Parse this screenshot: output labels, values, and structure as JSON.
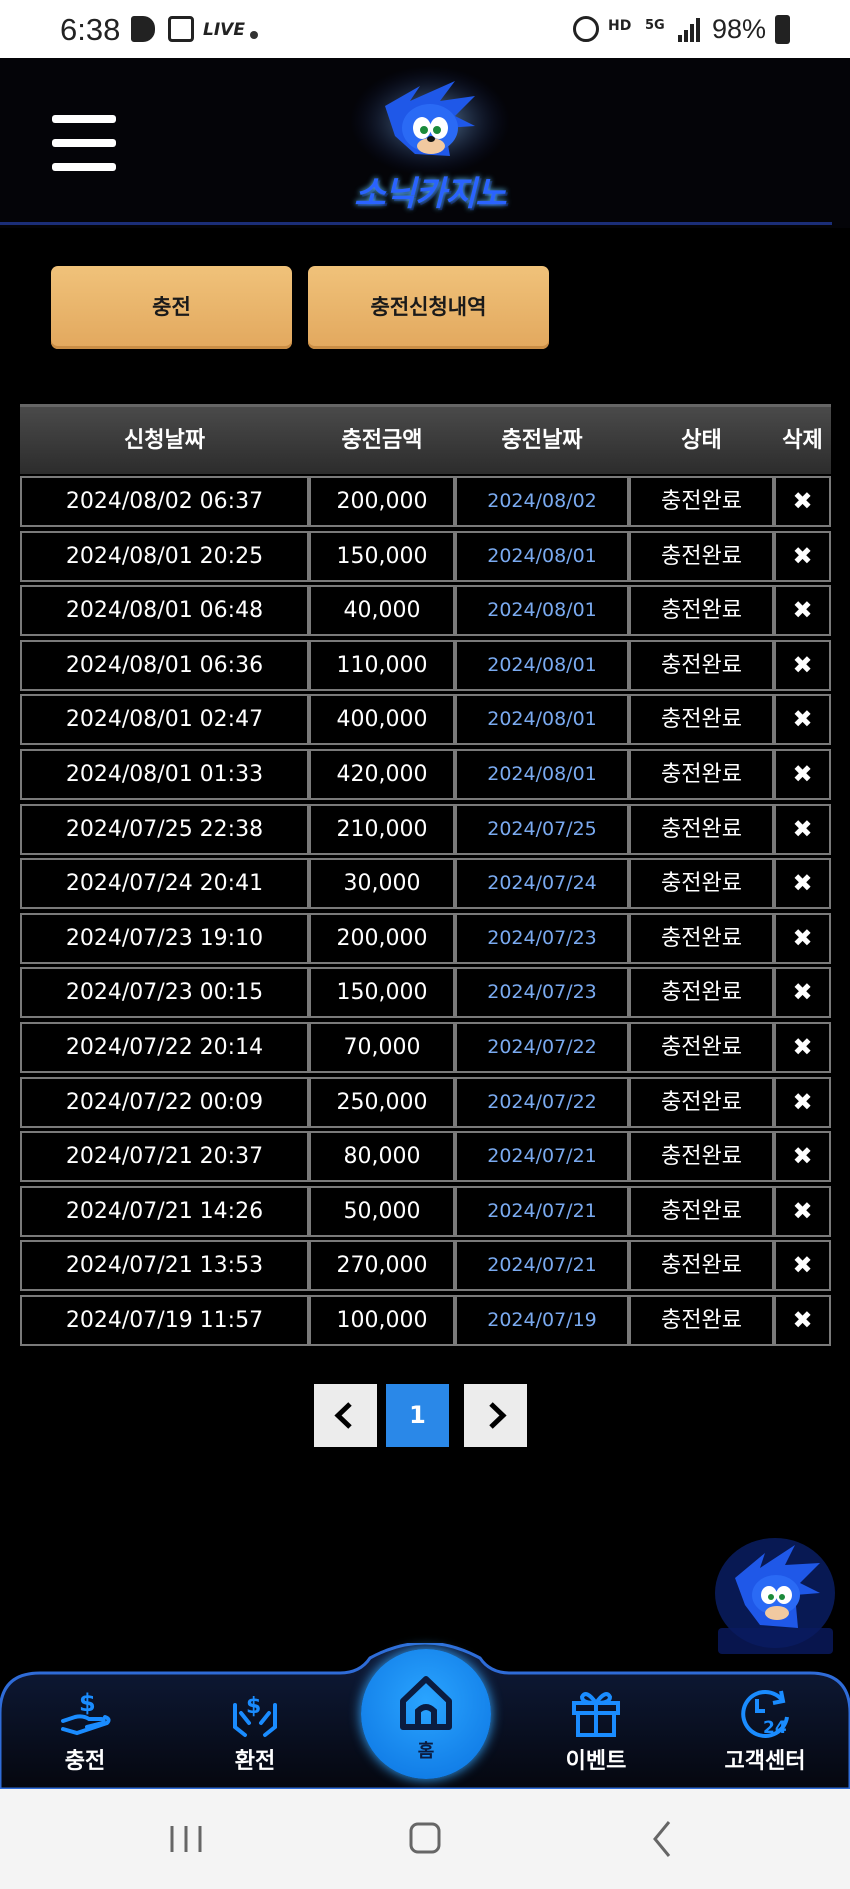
{
  "status_bar": {
    "time": "6:38",
    "live": "LIVE",
    "hd": "HD",
    "network": "5G",
    "battery": "98%"
  },
  "header": {
    "logo_text": "소닉카지노"
  },
  "buttons": {
    "charge": "충전",
    "history": "충전신청내역"
  },
  "table": {
    "headers": [
      "신청날짜",
      "충전금액",
      "충전날짜",
      "상태",
      "삭제"
    ],
    "delete_symbol": "✖",
    "rows": [
      {
        "request": "2024/08/02 06:37",
        "amount": "200,000",
        "date": "2024/08/02",
        "status": "충전완료"
      },
      {
        "request": "2024/08/01 20:25",
        "amount": "150,000",
        "date": "2024/08/01",
        "status": "충전완료"
      },
      {
        "request": "2024/08/01 06:48",
        "amount": "40,000",
        "date": "2024/08/01",
        "status": "충전완료"
      },
      {
        "request": "2024/08/01 06:36",
        "amount": "110,000",
        "date": "2024/08/01",
        "status": "충전완료"
      },
      {
        "request": "2024/08/01 02:47",
        "amount": "400,000",
        "date": "2024/08/01",
        "status": "충전완료"
      },
      {
        "request": "2024/08/01 01:33",
        "amount": "420,000",
        "date": "2024/08/01",
        "status": "충전완료"
      },
      {
        "request": "2024/07/25 22:38",
        "amount": "210,000",
        "date": "2024/07/25",
        "status": "충전완료"
      },
      {
        "request": "2024/07/24 20:41",
        "amount": "30,000",
        "date": "2024/07/24",
        "status": "충전완료"
      },
      {
        "request": "2024/07/23 19:10",
        "amount": "200,000",
        "date": "2024/07/23",
        "status": "충전완료"
      },
      {
        "request": "2024/07/23 00:15",
        "amount": "150,000",
        "date": "2024/07/23",
        "status": "충전완료"
      },
      {
        "request": "2024/07/22 20:14",
        "amount": "70,000",
        "date": "2024/07/22",
        "status": "충전완료"
      },
      {
        "request": "2024/07/22 00:09",
        "amount": "250,000",
        "date": "2024/07/22",
        "status": "충전완료"
      },
      {
        "request": "2024/07/21 20:37",
        "amount": "80,000",
        "date": "2024/07/21",
        "status": "충전완료"
      },
      {
        "request": "2024/07/21 14:26",
        "amount": "50,000",
        "date": "2024/07/21",
        "status": "충전완료"
      },
      {
        "request": "2024/07/21 13:53",
        "amount": "270,000",
        "date": "2024/07/21",
        "status": "충전완료"
      },
      {
        "request": "2024/07/19 11:57",
        "amount": "100,000",
        "date": "2024/07/19",
        "status": "충전완료"
      }
    ]
  },
  "pagination": {
    "prev": "‹",
    "current": "1",
    "next": "›"
  },
  "bottom_nav": {
    "charge": "충전",
    "exchange": "환전",
    "home": "홈",
    "event": "이벤트",
    "support": "고객센터"
  },
  "colors": {
    "accent_button": "#e8b36a",
    "nav_blue": "#1a8cff",
    "page_active": "#2a88e8",
    "date_link": "#7aaaf0"
  },
  "icons": [
    "menu-icon",
    "sonic-logo",
    "delete-icon",
    "chevron-left-icon",
    "chevron-right-icon",
    "charge-hand-icon",
    "exchange-hands-icon",
    "home-icon",
    "gift-icon",
    "support-24-icon"
  ]
}
